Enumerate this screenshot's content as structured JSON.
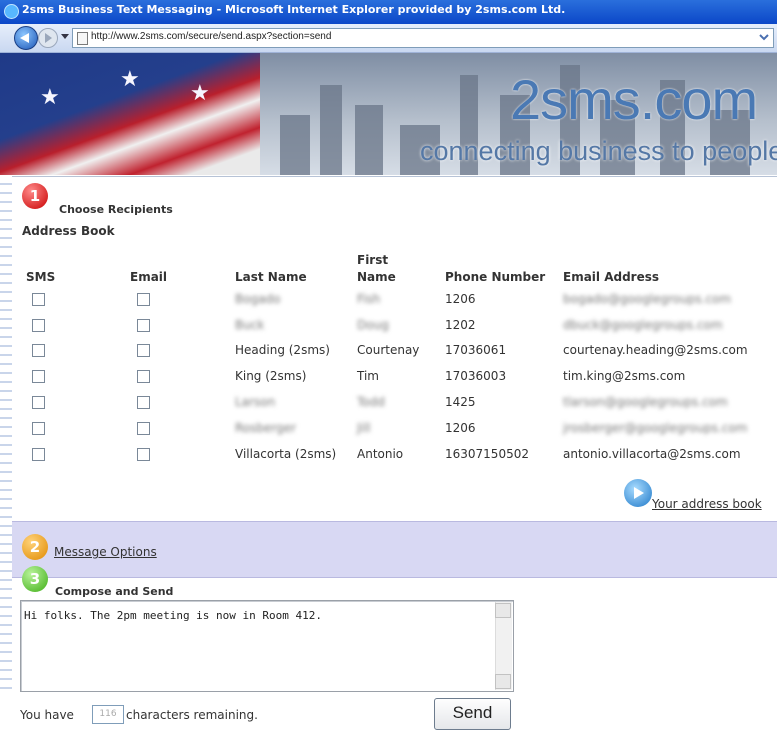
{
  "window": {
    "title": "2sms Business Text Messaging - Microsoft Internet Explorer provided by 2sms.com Ltd.",
    "url": "http://www.2sms.com/secure/send.aspx?section=send"
  },
  "banner": {
    "logo": "2sms.com",
    "tagline": "connecting business to people"
  },
  "recipients": {
    "step_number": "1",
    "step_label": "Choose Recipients",
    "section_title": "Address Book",
    "headers": {
      "sms": "SMS",
      "email": "Email",
      "last_name": "Last Name",
      "first_name": "First Name",
      "phone": "Phone Number",
      "email_address": "Email Address"
    },
    "rows": [
      {
        "last": "Bogado",
        "first": "Fish",
        "phone": "1206",
        "email": "bogado@googlegroups.com"
      },
      {
        "last": "Buck",
        "first": "Doug",
        "phone": "1202",
        "email": "dbuck@googlegroups.com"
      },
      {
        "last": "Heading (2sms)",
        "first": "Courtenay",
        "phone": "17036061",
        "email": "courtenay.heading@2sms.com"
      },
      {
        "last": "King (2sms)",
        "first": "Tim",
        "phone": "17036003",
        "email": "tim.king@2sms.com"
      },
      {
        "last": "Larson",
        "first": "Todd",
        "phone": "1425",
        "email": "tlarson@googlegroups.com"
      },
      {
        "last": "Rosberger",
        "first": "Jill",
        "phone": "1206",
        "email": "jrosberger@googlegroups.com"
      },
      {
        "last": "Villacorta (2sms)",
        "first": "Antonio",
        "phone": "16307150502",
        "email": "antonio.villacorta@2sms.com"
      }
    ],
    "address_book_link": "Your address book"
  },
  "message_options": {
    "step_number": "2",
    "label": "Message Options"
  },
  "compose": {
    "step_number": "3",
    "label": "Compose and Send",
    "message": "Hi folks. The 2pm meeting is now in Room 412.",
    "chars_prefix": "You have",
    "chars_value": "116",
    "chars_suffix": "characters remaining.",
    "send_label": "Send"
  },
  "colors": {
    "title_blue": "#0b47c8",
    "options_band": "#d8d8f3",
    "step1_red": "#c90000",
    "step2_orange": "#e08a00",
    "step3_green": "#3fae16"
  }
}
